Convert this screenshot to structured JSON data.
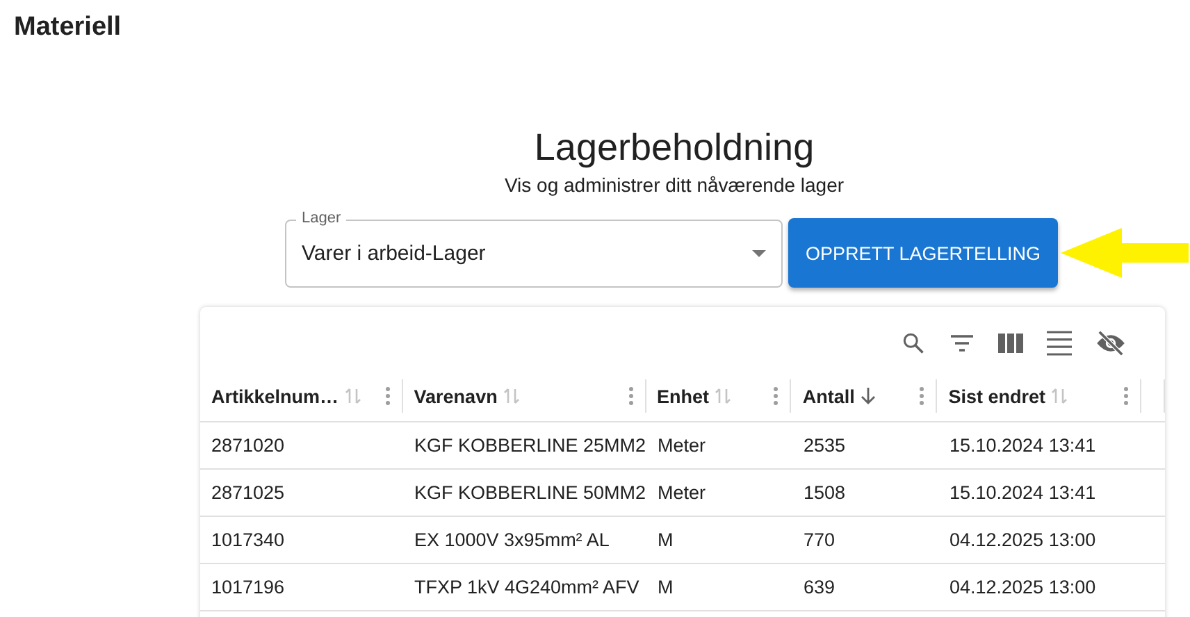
{
  "page_title": "Materiell",
  "heading": "Lagerbeholdning",
  "subtitle": "Vis og administrer ditt nåværende lager",
  "warehouse_select": {
    "label": "Lager",
    "value": "Varer i arbeid-Lager"
  },
  "create_button": "OPPRETT LAGERTELLING",
  "table": {
    "columns": [
      {
        "label": "Artikkelnum…",
        "sorted": false
      },
      {
        "label": "Varenavn",
        "sorted": false
      },
      {
        "label": "Enhet",
        "sorted": false
      },
      {
        "label": "Antall",
        "sorted": true
      },
      {
        "label": "Sist endret",
        "sorted": false
      }
    ],
    "rows": [
      [
        "2871020",
        "KGF KOBBERLINE 25MM2",
        "Meter",
        "2535",
        "15.10.2024 13:41"
      ],
      [
        "2871025",
        "KGF KOBBERLINE 50MM2",
        "Meter",
        "1508",
        "15.10.2024 13:41"
      ],
      [
        "1017340",
        "EX 1000V 3x95mm² AL",
        "M",
        "770",
        "04.12.2025 13:00"
      ],
      [
        "1017196",
        "TFXP 1kV 4G240mm² AFV",
        "M",
        "639",
        "04.12.2025 13:00"
      ]
    ]
  }
}
